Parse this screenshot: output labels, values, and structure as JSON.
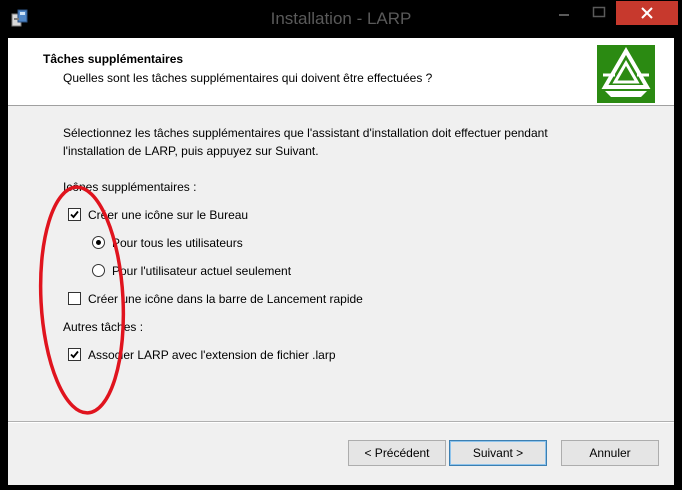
{
  "window": {
    "title": "Installation - LARP",
    "icons": [
      "setup-app-icon",
      "minimize-icon",
      "maximize-icon",
      "close-icon"
    ]
  },
  "header": {
    "title": "Tâches supplémentaires",
    "subtitle": "Quelles sont les tâches supplémentaires qui doivent être effectuées ?",
    "logo_color": "#2b8a12"
  },
  "body": {
    "intro_line1": "Sélectionnez les tâches supplémentaires que l'assistant d'installation doit effectuer pendant",
    "intro_line2": "l'installation de LARP, puis appuyez sur Suivant.",
    "group1_label": "Icônes supplémentaires :",
    "desktop_icon_label": "Créer une icône sur le Bureau",
    "desktop_icon_checked": true,
    "all_users_label": "Pour tous les utilisateurs",
    "all_users_selected": true,
    "current_user_label": "Pour l'utilisateur actuel seulement",
    "current_user_selected": false,
    "quicklaunch_label": "Créer une icône dans la barre de Lancement rapide",
    "quicklaunch_checked": false,
    "group2_label": "Autres tâches :",
    "associate_label": "Associer LARP avec l'extension de fichier .larp",
    "associate_checked": true
  },
  "buttons": {
    "back": "< Précédent",
    "next": "Suivant >",
    "cancel": "Annuler"
  },
  "annotation_color": "#e0141e"
}
